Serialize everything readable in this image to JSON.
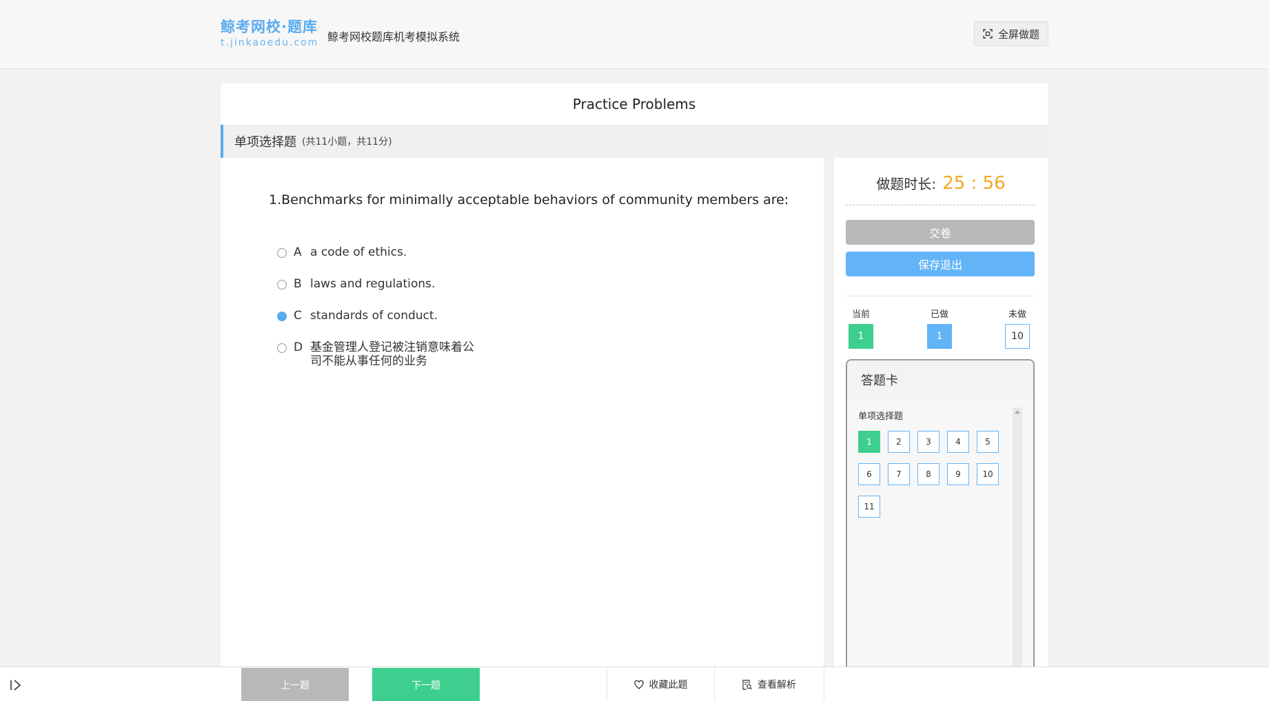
{
  "header": {
    "logo_cn": "鲸考网校·题库",
    "logo_en": "t.jinkaoedu.com",
    "system_title": "鲸考网校题库机考模拟系统",
    "fullscreen_label": "全屏做题"
  },
  "paper": {
    "title": "Practice Problems"
  },
  "section": {
    "name": "单项选择题",
    "meta": "(共11小题，共11分)"
  },
  "question": {
    "text": "1.Benchmarks for minimally acceptable behaviors of community members are:",
    "options": [
      {
        "letter": "A",
        "text": "a code of ethics.",
        "selected": false
      },
      {
        "letter": "B",
        "text": "laws and regulations.",
        "selected": false
      },
      {
        "letter": "C",
        "text": "standards of conduct.",
        "selected": true
      },
      {
        "letter": "D",
        "text": "基金管理人登记被注销意味着公司不能从事任何的业务",
        "selected": false
      }
    ]
  },
  "sidebar": {
    "timer_label": "做题时长:",
    "timer_value": "25 : 56",
    "submit_label": "交卷",
    "save_exit_label": "保存退出",
    "legend": {
      "current_label": "当前",
      "current_value": "1",
      "done_label": "已做",
      "done_value": "1",
      "undone_label": "未做",
      "undone_value": "10"
    },
    "answer_card": {
      "title": "答题卡",
      "section_name": "单项选择题",
      "numbers": [
        "1",
        "2",
        "3",
        "4",
        "5",
        "6",
        "7",
        "8",
        "9",
        "10",
        "11"
      ],
      "current": "1"
    }
  },
  "bottom_bar": {
    "prev_label": "上一题",
    "next_label": "下一题",
    "favorite_label": "收藏此题",
    "analysis_label": "查看解析"
  },
  "colors": {
    "accent_blue": "#63b3f7",
    "accent_green": "#3ecf8e",
    "timer_orange": "#f5a623",
    "disabled_gray": "#b8b8b8"
  }
}
